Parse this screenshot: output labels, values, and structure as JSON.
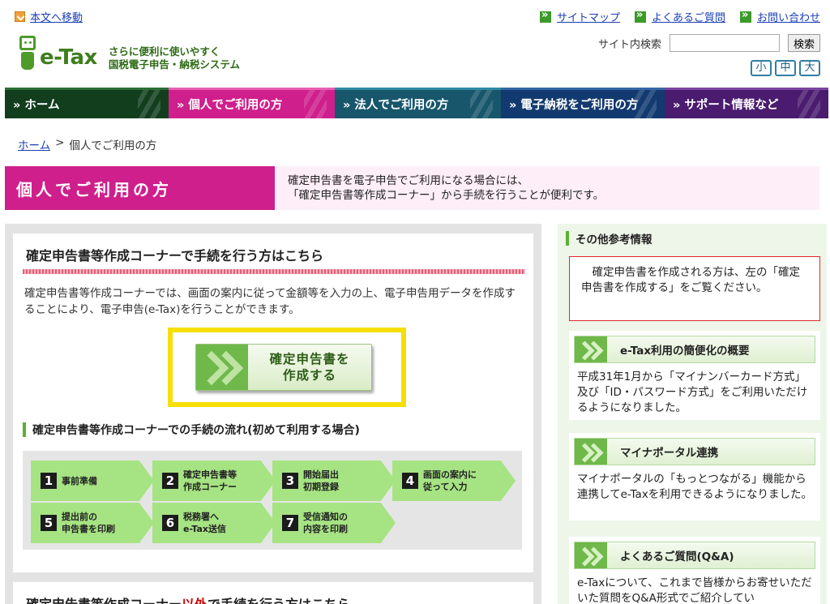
{
  "header": {
    "skip_link": "本文へ移動",
    "top_links": [
      "サイトマップ",
      "よくあるご質問",
      "お問い合わせ"
    ],
    "brand": "e-Tax",
    "tagline_line1": "さらに便利に使いやすく",
    "tagline_line2": "国税電子申告・納税システム",
    "search_label": "サイト内検索",
    "search_value": "",
    "search_button": "検索",
    "font_sizes": [
      "小",
      "中",
      "大"
    ]
  },
  "nav": [
    {
      "label": "» ホーム",
      "color": "#123e1e"
    },
    {
      "label": "» 個人でご利用の方",
      "color": "#cf1f8c"
    },
    {
      "label": "» 法人でご利用の方",
      "color": "#17566b"
    },
    {
      "label": "» 電子納税をご利用の方",
      "color": "#123a70"
    },
    {
      "label": "» サポート情報など",
      "color": "#4a1b6e"
    }
  ],
  "breadcrumb": {
    "home": "ホーム",
    "sep": ">",
    "current": "個人でご利用の方"
  },
  "page": {
    "title": "個人でご利用の方",
    "intro_line1": "確定申告書を電子申告でご利用になる場合には、",
    "intro_line2": "「確定申告書等作成コーナー」から手続を行うことが便利です。"
  },
  "main": {
    "section_title": "確定申告書等作成コーナーで手続を行う方はこちら",
    "description": "確定申告書等作成コーナーでは、画面の案内に従って金額等を入力の上、電子申告用データを作成することにより、電子申告(e-Tax)を行うことができます。",
    "cta_line1": "確定申告書を",
    "cta_line2": "作成する",
    "flow_title": "確定申告書等作成コーナーでの手続の流れ(初めて利用する場合)",
    "steps": [
      {
        "num": "1",
        "line1": "事前準備",
        "line2": ""
      },
      {
        "num": "2",
        "line1": "確定申告書等",
        "line2": "作成コーナー"
      },
      {
        "num": "3",
        "line1": "開始届出",
        "line2": "初期登録"
      },
      {
        "num": "4",
        "line1": "画面の案内に",
        "line2": "従って入力"
      },
      {
        "num": "5",
        "line1": "提出前の",
        "line2": "申告書を印刷"
      },
      {
        "num": "6",
        "line1": "税務署へ",
        "line2": "e-Tax送信"
      },
      {
        "num": "7",
        "line1": "受信通知の",
        "line2": "内容を印刷"
      }
    ],
    "section2_title_a": "確定申告書等作成コーナー",
    "section2_title_red": "以外",
    "section2_title_b": "で手続を行う方はこちら"
  },
  "sidebar": {
    "heading": "その他参考情報",
    "note": "確定申告書を作成される方は、左の「確定申告書を作成する」をご覧ください。",
    "blocks": [
      {
        "title": "e-Tax利用の簡便化の概要",
        "body": "平成31年1月から「マイナンバーカード方式」及び「ID・パスワード方式」をご利用いただけるようになりました。"
      },
      {
        "title": "マイナポータル連携",
        "body": "マイナポータルの「もっとつながる」機能から連携してe-Taxを利用できるようになりました。"
      },
      {
        "title": "よくあるご質問(Q&A)",
        "body": "e-Taxについて、これまで皆様からお寄せいただいた質問をQ&A形式でご紹介してい"
      }
    ]
  }
}
